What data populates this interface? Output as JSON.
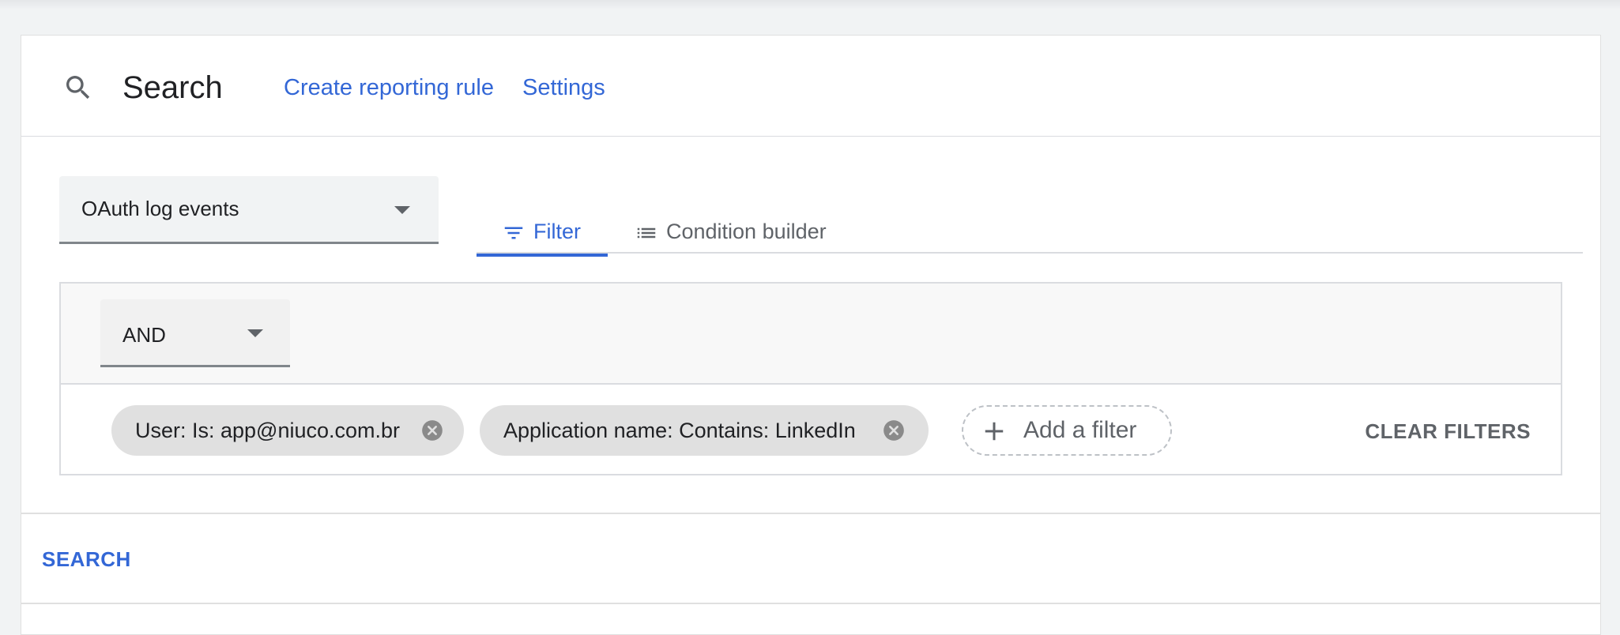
{
  "header": {
    "title": "Search",
    "links": {
      "create_rule": "Create reporting rule",
      "settings": "Settings"
    }
  },
  "source_select": {
    "value": "OAuth log events"
  },
  "tabs": {
    "filter": "Filter",
    "condition_builder": "Condition builder",
    "active": "filter"
  },
  "operator_select": {
    "value": "AND"
  },
  "filters": [
    {
      "label": "User: Is: app@niuco.com.br"
    },
    {
      "label": "Application name: Contains: LinkedIn"
    }
  ],
  "add_filter_label": "Add a filter",
  "clear_filters_label": "CLEAR FILTERS",
  "search_button_label": "SEARCH",
  "colors": {
    "accent": "#3367d6",
    "chip_bg": "#e0e0e0",
    "text_secondary": "#5f6368"
  },
  "icons": {
    "header": "search-icon",
    "filter_tab": "filter-icon",
    "condition_tab": "list-icon",
    "chip_remove": "remove-circle-icon",
    "add": "plus-icon",
    "dropdown": "caret-down-icon"
  }
}
